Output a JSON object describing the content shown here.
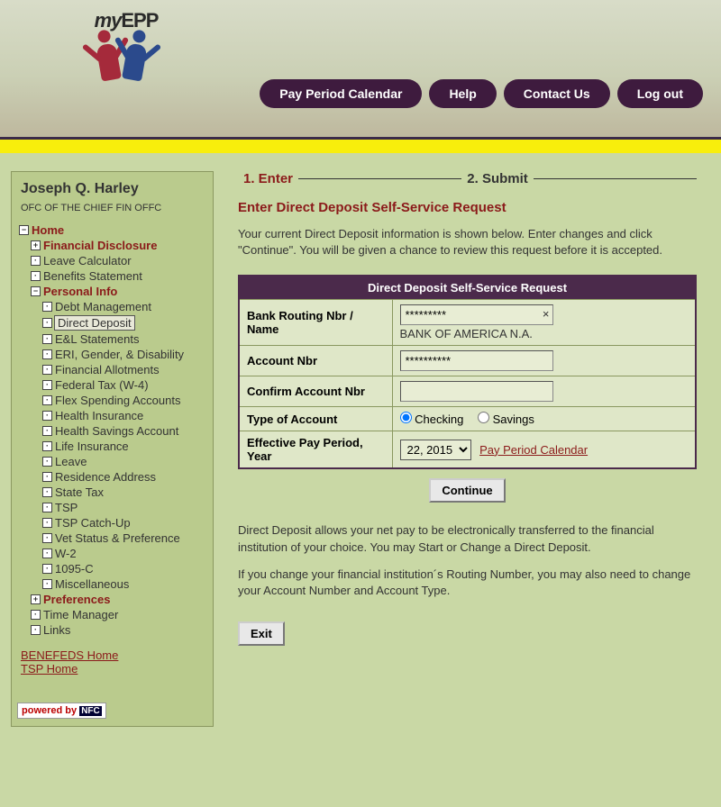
{
  "logo": {
    "text1": "my",
    "text2": "EPP"
  },
  "topnav": [
    "Pay Period Calendar",
    "Help",
    "Contact Us",
    "Log out"
  ],
  "user": {
    "name": "Joseph Q. Harley",
    "dept": "OFC OF THE CHIEF FIN OFFC"
  },
  "tree": {
    "home": "Home",
    "fin_disc": "Financial Disclosure",
    "leave_calc": "Leave Calculator",
    "benefits": "Benefits Statement",
    "personal": "Personal Info",
    "personal_items": [
      "Debt Management",
      "Direct Deposit",
      "E&L Statements",
      "ERI, Gender, & Disability",
      "Financial Allotments",
      "Federal Tax (W-4)",
      "Flex Spending Accounts",
      "Health Insurance",
      "Health Savings Account",
      "Life Insurance",
      "Leave",
      "Residence Address",
      "State Tax",
      "TSP",
      "TSP Catch-Up",
      "Vet Status & Preference",
      "W-2",
      "1095-C",
      "Miscellaneous"
    ],
    "prefs": "Preferences",
    "time_mgr": "Time Manager",
    "links": "Links"
  },
  "ext_links": [
    "BENEFEDS Home",
    "TSP Home"
  ],
  "powered": {
    "a": "powered by",
    "b": "NFC"
  },
  "steps": {
    "s1": "1. Enter",
    "s2": "2. Submit"
  },
  "page_title": "Enter Direct Deposit Self-Service Request",
  "intro": "Your current Direct Deposit information is shown below. Enter changes and click \"Continue\". You will be given a chance to review this request before it is accepted.",
  "form": {
    "header": "Direct Deposit Self-Service Request",
    "routing_lbl": "Bank Routing Nbr / Name",
    "routing_val": "*********",
    "bank_name": "BANK OF AMERICA N.A.",
    "acct_lbl": "Account Nbr",
    "acct_val": "**********",
    "confirm_lbl": "Confirm Account Nbr",
    "confirm_val": "",
    "type_lbl": "Type of Account",
    "type_check": "Checking",
    "type_sav": "Savings",
    "eff_lbl": "Effective Pay Period, Year",
    "eff_val": "22, 2015",
    "pp_link": "Pay Period Calendar",
    "continue": "Continue"
  },
  "info1": "Direct Deposit allows your net pay to be electronically transferred to the financial institution of your choice. You may Start or Change a Direct Deposit.",
  "info2": "If you change your financial institution´s Routing Number, you may also need to change your Account Number and Account Type.",
  "exit": "Exit",
  "clear_x": "×"
}
